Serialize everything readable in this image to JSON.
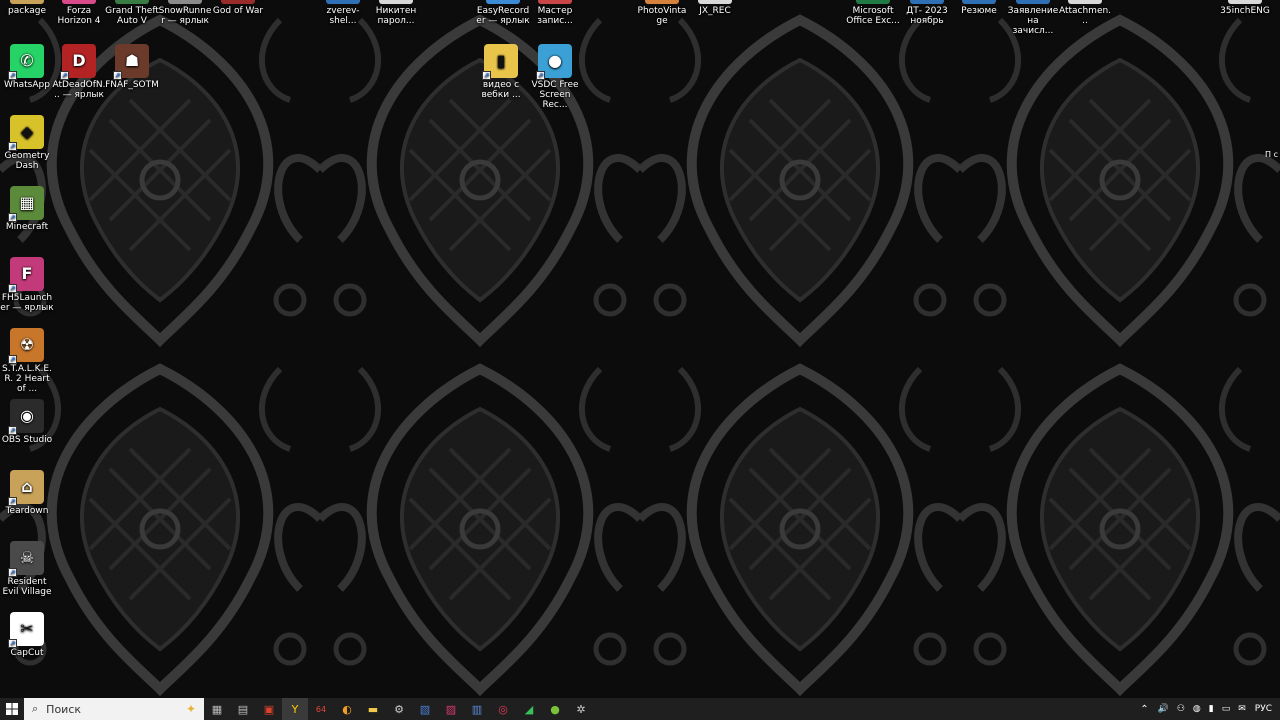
{
  "desktop": {
    "top_row": [
      {
        "label": "package",
        "color": "#c9a25a"
      },
      {
        "label": "Forza Horizon 4",
        "color": "#d84a8a"
      },
      {
        "label": "Grand Theft Auto V",
        "color": "#3a7d44"
      },
      {
        "label": "SnowRunner — ярлык",
        "color": "#8a8a8a"
      },
      {
        "label": "God of War",
        "color": "#9a2b2b"
      },
      {
        "label": "zverev-shel...",
        "color": "#2f6fb5"
      },
      {
        "label": "Никитен парол...",
        "color": "#d8d8d8"
      },
      {
        "label": "EasyRecorder — ярлык",
        "color": "#3c8bd6"
      },
      {
        "label": "Мастер запис...",
        "color": "#c94646"
      },
      {
        "label": "PhotoVintage",
        "color": "#d6813c"
      },
      {
        "label": "JX_REC",
        "color": "#d8d8d8"
      },
      {
        "label": "Microsoft Office Exc...",
        "color": "#1f7a43"
      },
      {
        "label": "ДТ- 2023 ноябрь",
        "color": "#2f6fb5"
      },
      {
        "label": "Резюме",
        "color": "#2f6fb5"
      },
      {
        "label": "Заявление на зачисл...",
        "color": "#2f6fb5"
      },
      {
        "label": "Attachmen...",
        "color": "#d8d8d8"
      },
      {
        "label": "35inchENG",
        "color": "#d8d8d8"
      }
    ],
    "left_column": [
      {
        "label": "WhatsApp",
        "glyph": "✆",
        "color": "#25d366"
      },
      {
        "label": "Geometry Dash",
        "glyph": "◆",
        "color": "#d7c22a"
      },
      {
        "label": "Minecraft",
        "glyph": "▦",
        "color": "#5b8a3a"
      },
      {
        "label": "FH5Launcher — ярлык",
        "glyph": "F",
        "color": "#c23a7a"
      },
      {
        "label": "S.T.A.L.K.E.R. 2 Heart of ...",
        "glyph": "☢",
        "color": "#c7762a"
      },
      {
        "label": "OBS Studio",
        "glyph": "◉",
        "color": "#2b2b2b"
      },
      {
        "label": "Teardown",
        "glyph": "⌂",
        "color": "#c9a25a"
      },
      {
        "label": "Resident Evil Village",
        "glyph": "☠",
        "color": "#4a4a4a"
      },
      {
        "label": "CapCut",
        "glyph": "✂",
        "color": "#ffffff"
      }
    ],
    "second_row": [
      {
        "label": "AtDeadOfN... — ярлык",
        "glyph": "D",
        "color": "#b32323"
      },
      {
        "label": "FNAF_SOTM",
        "glyph": "☗",
        "color": "#6b3a2a"
      },
      {
        "label": "видео с вебки ...",
        "glyph": "▮",
        "color": "#e8c54a"
      },
      {
        "label": "VSDC Free Screen Rec...",
        "glyph": "●",
        "color": "#3aa0d6"
      }
    ],
    "edge_text": "П с"
  },
  "taskbar": {
    "search_placeholder": "Поиск",
    "apps": [
      {
        "name": "task-view",
        "glyph": "▦",
        "color": "#bbbbbb"
      },
      {
        "name": "explorer-pin",
        "glyph": "▤",
        "color": "#bbbbbb"
      },
      {
        "name": "app-red-1",
        "glyph": "▣",
        "color": "#d8432a"
      },
      {
        "name": "yandex-browser",
        "glyph": "Y",
        "color": "#ffcc00",
        "active": true
      },
      {
        "name": "app-64",
        "glyph": "64",
        "color": "#e8453c"
      },
      {
        "name": "chrome-like",
        "glyph": "◐",
        "color": "#f0a020"
      },
      {
        "name": "file-explorer",
        "glyph": "▬",
        "color": "#f2c94c"
      },
      {
        "name": "settings",
        "glyph": "⚙",
        "color": "#cccccc"
      },
      {
        "name": "app-blue",
        "glyph": "▧",
        "color": "#4a7fd6"
      },
      {
        "name": "app-pink",
        "glyph": "▨",
        "color": "#d63a6a"
      },
      {
        "name": "app-doc",
        "glyph": "▥",
        "color": "#5a8ad6"
      },
      {
        "name": "app-rec",
        "glyph": "◎",
        "color": "#e83a5a"
      },
      {
        "name": "app-green",
        "glyph": "◢",
        "color": "#3ac25a"
      },
      {
        "name": "app-lime",
        "glyph": "●",
        "color": "#7ac23a"
      },
      {
        "name": "app-gear",
        "glyph": "✲",
        "color": "#cccccc"
      }
    ],
    "tray": {
      "chevron": "⌃",
      "icons": [
        "🔊",
        "⚇",
        "◍",
        "▮",
        "▭",
        "✉"
      ],
      "lang": "РУС"
    }
  }
}
